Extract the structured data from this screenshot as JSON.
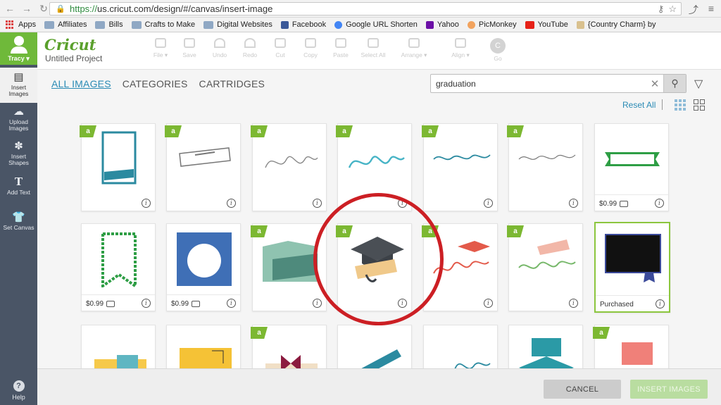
{
  "browser": {
    "url_scheme": "https://",
    "url_rest": "us.cricut.com/design/#/canvas/insert-image",
    "bookmarks": [
      "Apps",
      "Affiliates",
      "Bills",
      "Crafts to Make",
      "Digital Websites",
      "Facebook",
      "Google URL Shorten",
      "Yahoo",
      "PicMonkey",
      "YouTube",
      "{Country Charm} by"
    ]
  },
  "sidebar": {
    "user": "Tracy ▾",
    "items": [
      {
        "label": "Insert Images",
        "icon": "image-icon"
      },
      {
        "label": "Upload Images",
        "icon": "upload-icon"
      },
      {
        "label": "Insert Shapes",
        "icon": "shapes-icon"
      },
      {
        "label": "Add Text",
        "icon": "text-icon"
      },
      {
        "label": "Set Canvas",
        "icon": "shirt-icon"
      }
    ],
    "help": "Help"
  },
  "header": {
    "logo": "Cricut",
    "project": "Untitled Project",
    "tools": [
      "File ▾",
      "Save",
      "Undo",
      "Redo",
      "Cut",
      "Copy",
      "Paste",
      "Select All",
      "Arrange ▾",
      "Align ▾",
      "Go"
    ]
  },
  "tabs": [
    "ALL IMAGES",
    "CATEGORIES",
    "CARTRIDGES"
  ],
  "search": {
    "value": "graduation"
  },
  "reset": "Reset All",
  "cards": {
    "price": "$0.99",
    "purchased": "Purchased",
    "badge": "a",
    "info": "i"
  },
  "footer": {
    "cancel": "CANCEL",
    "insert": "INSERT IMAGES"
  },
  "colors": {
    "accent": "#7cb832",
    "link": "#2a8bb5",
    "highlight": "#cc1f24",
    "sidebar": "#4a5566"
  }
}
